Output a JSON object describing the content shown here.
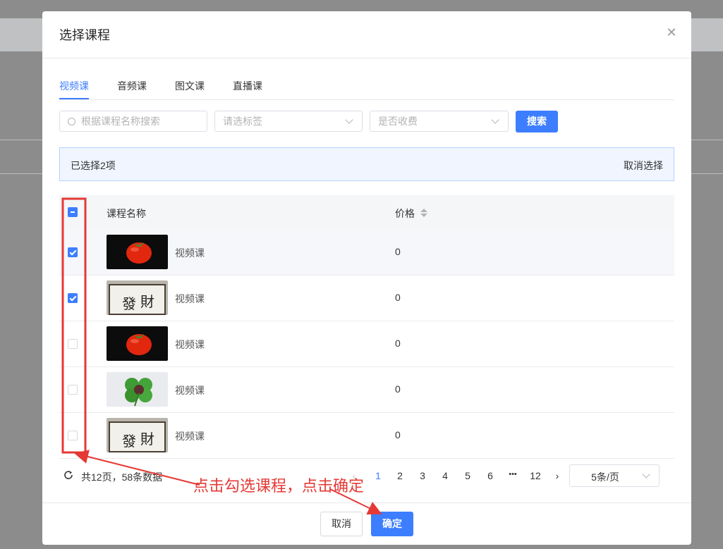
{
  "modal": {
    "title": "选择课程",
    "close_icon": "close-icon"
  },
  "tabs": [
    {
      "label": "视频课",
      "active": true
    },
    {
      "label": "音频课",
      "active": false
    },
    {
      "label": "图文课",
      "active": false
    },
    {
      "label": "直播课",
      "active": false
    }
  ],
  "filters": {
    "search_placeholder": "根据课程名称搜索",
    "tag_placeholder": "请选标签",
    "fee_placeholder": "是否收费",
    "search_button": "搜索"
  },
  "selection": {
    "summary": "已选择2项",
    "cancel_label": "取消选择"
  },
  "table": {
    "headers": {
      "name": "课程名称",
      "price": "价格"
    },
    "rows": [
      {
        "checked": true,
        "thumb": "tomato",
        "name": "视频课",
        "price": "0"
      },
      {
        "checked": true,
        "thumb": "calligraphy",
        "name": "视频课",
        "price": "0"
      },
      {
        "checked": false,
        "thumb": "tomato",
        "name": "视频课",
        "price": "0"
      },
      {
        "checked": false,
        "thumb": "clover",
        "name": "视频课",
        "price": "0"
      },
      {
        "checked": false,
        "thumb": "calligraphy",
        "name": "视频课",
        "price": "0"
      }
    ]
  },
  "pagination": {
    "summary": "共12页，58条数据",
    "prev": "‹",
    "next": "›",
    "pages": [
      "1",
      "2",
      "3",
      "4",
      "5",
      "6",
      "•••",
      "12"
    ],
    "current": "1",
    "page_size": "5条/页"
  },
  "footer": {
    "cancel": "取消",
    "confirm": "确定"
  },
  "annotation": {
    "text": "点击勾选课程，点击确定",
    "color": "#e53935"
  },
  "colors": {
    "primary": "#3d7eff"
  }
}
